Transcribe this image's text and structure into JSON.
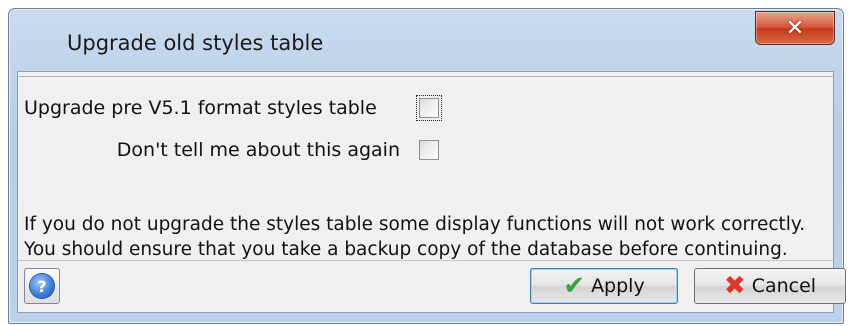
{
  "window": {
    "title": "Upgrade old styles table",
    "close_glyph": "✕"
  },
  "options": {
    "upgrade_label": "Upgrade pre V5.1 format styles table",
    "upgrade_checked": false,
    "dont_tell_label": "Don't tell me about this again",
    "dont_tell_checked": false
  },
  "message": {
    "line1": "If you do not upgrade the styles table some display functions will not work correctly.",
    "line2": "You should ensure that you take a backup copy of the database before continuing."
  },
  "footer": {
    "help_glyph": "?",
    "apply_icon": "✔",
    "apply_label": "Apply",
    "cancel_icon": "✖",
    "cancel_label": "Cancel"
  },
  "colors": {
    "close_button_red": "#c4391c",
    "apply_check_green": "#3ca23c",
    "cancel_x_red": "#e0352b",
    "help_blue": "#2c6fce"
  }
}
